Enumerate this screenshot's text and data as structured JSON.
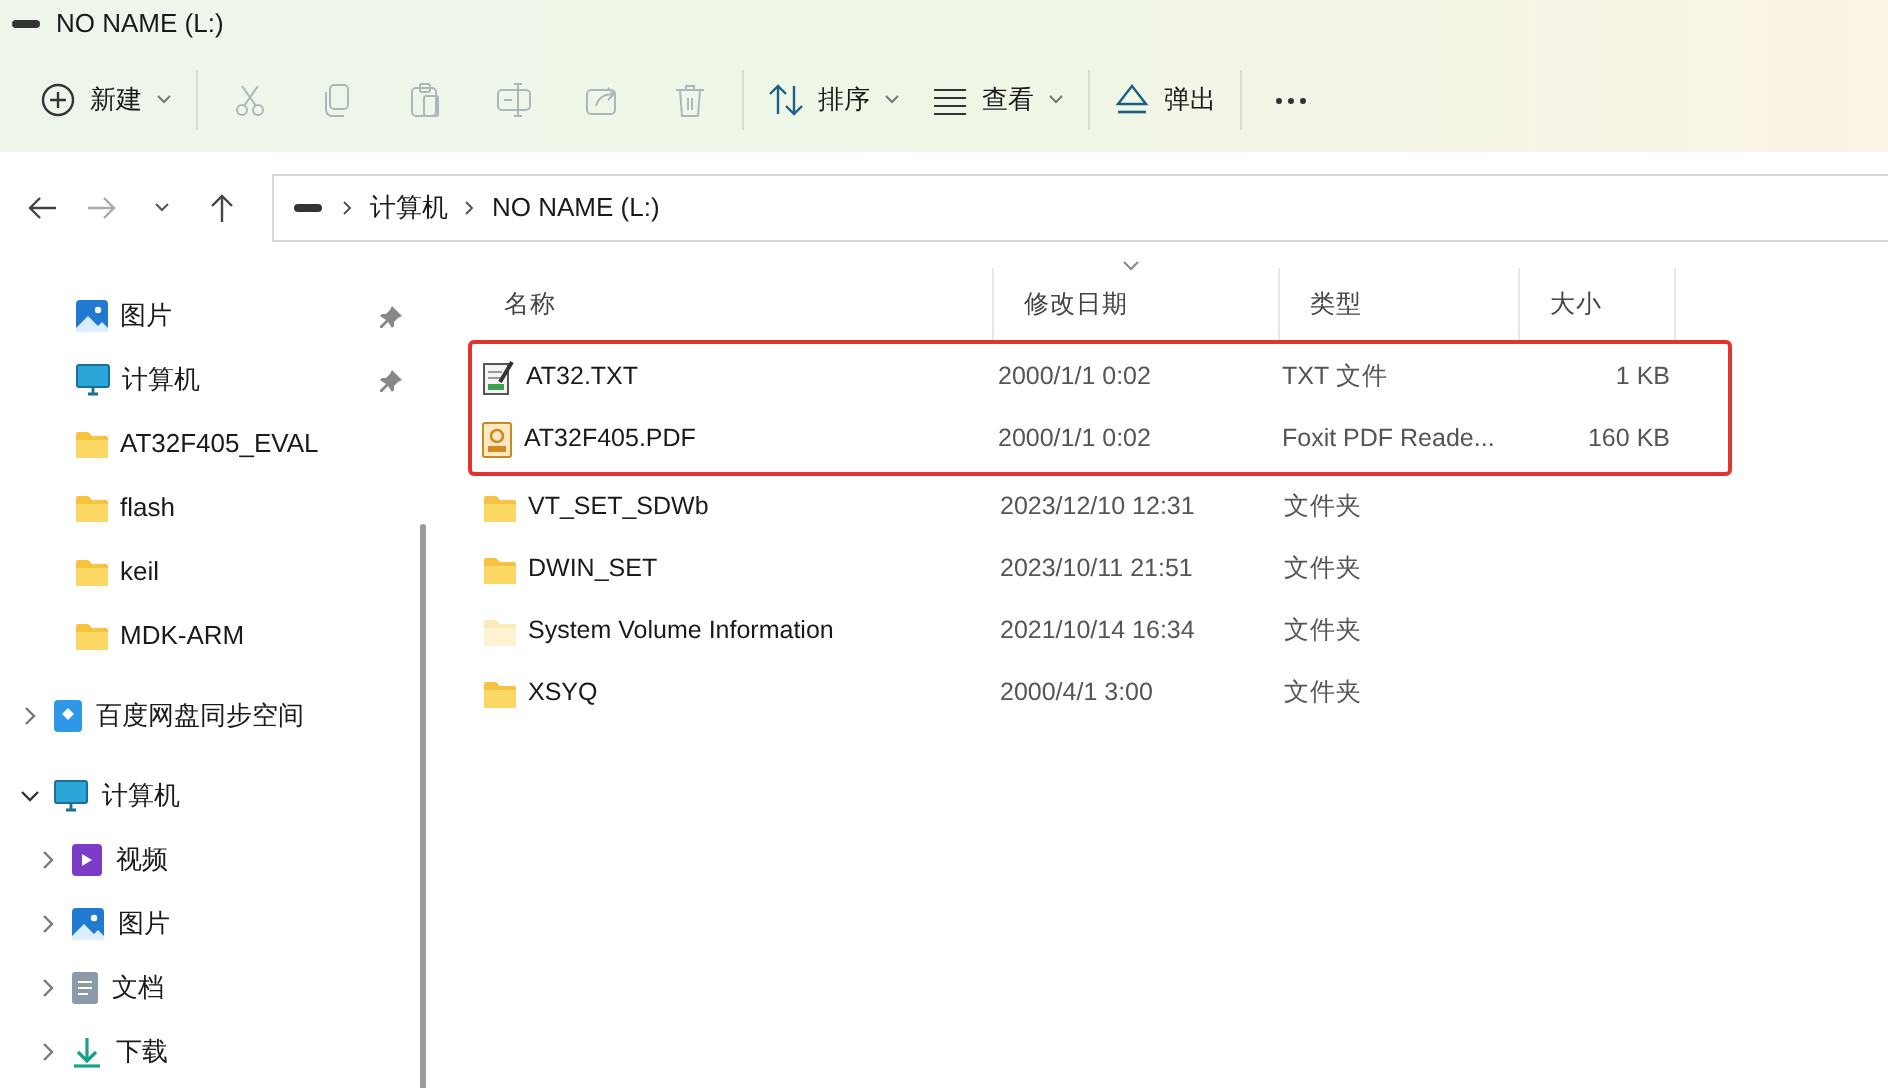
{
  "window": {
    "title": "NO NAME (L:)"
  },
  "toolbar": [
    {
      "kind": "new",
      "label": "新建",
      "disabled": false,
      "dropdown": true
    },
    {
      "kind": "cut",
      "disabled": true,
      "dropdown": false
    },
    {
      "kind": "copy",
      "disabled": true,
      "dropdown": false
    },
    {
      "kind": "paste",
      "disabled": true,
      "dropdown": false
    },
    {
      "kind": "rename",
      "disabled": true,
      "dropdown": false
    },
    {
      "kind": "share",
      "disabled": true,
      "dropdown": false
    },
    {
      "kind": "delete",
      "disabled": true,
      "dropdown": false
    },
    {
      "kind": "sort",
      "label": "排序",
      "disabled": false,
      "dropdown": true
    },
    {
      "kind": "view",
      "label": "查看",
      "disabled": false,
      "dropdown": true
    },
    {
      "kind": "eject",
      "label": "弹出",
      "disabled": false,
      "dropdown": false
    },
    {
      "kind": "more",
      "disabled": false,
      "dropdown": false
    }
  ],
  "navigation": {
    "back_disabled": false,
    "forward_disabled": true
  },
  "address_bar": {
    "crumbs": [
      "计算机",
      "NO NAME (L:)"
    ]
  },
  "sidebar": {
    "quick_access": [
      {
        "kind": "picture",
        "label": "图片",
        "pinned": true
      },
      {
        "kind": "computer",
        "label": "计算机",
        "pinned": true
      },
      {
        "kind": "folder",
        "label": "AT32F405_EVAL",
        "pinned": false
      },
      {
        "kind": "folder",
        "label": "flash",
        "pinned": false
      },
      {
        "kind": "folder",
        "label": "keil",
        "pinned": false
      },
      {
        "kind": "folder",
        "label": "MDK-ARM",
        "pinned": false
      }
    ],
    "tree": [
      {
        "kind": "cloud",
        "label": "百度网盘同步空间",
        "expanded": false
      },
      {
        "kind": "computer",
        "label": "计算机",
        "expanded": true,
        "children": [
          {
            "kind": "video",
            "label": "视频",
            "expanded": false
          },
          {
            "kind": "picture",
            "label": "图片",
            "expanded": false
          },
          {
            "kind": "document",
            "label": "文档",
            "expanded": false
          },
          {
            "kind": "download",
            "label": "下载",
            "expanded": false
          }
        ]
      }
    ]
  },
  "table": {
    "columns": [
      {
        "label": "名称",
        "sorted": false
      },
      {
        "label": "修改日期",
        "sorted": true
      },
      {
        "label": "类型",
        "sorted": false
      },
      {
        "label": "大小",
        "sorted": false
      }
    ],
    "rows": [
      {
        "kind": "text",
        "name": "AT32.TXT",
        "date": "2000/1/1 0:02",
        "type": "TXT 文件",
        "size": "1 KB",
        "highlighted": true,
        "hidden": false
      },
      {
        "kind": "pdf",
        "name": "AT32F405.PDF",
        "date": "2000/1/1 0:02",
        "type": "Foxit PDF Reade...",
        "size": "160 KB",
        "highlighted": true,
        "hidden": false
      },
      {
        "kind": "folder",
        "name": "VT_SET_SDWb",
        "date": "2023/12/10 12:31",
        "type": "文件夹",
        "highlighted": false,
        "hidden": false
      },
      {
        "kind": "folder",
        "name": "DWIN_SET",
        "date": "2023/10/11 21:51",
        "type": "文件夹",
        "highlighted": false,
        "hidden": false
      },
      {
        "kind": "folder",
        "name": "System Volume Information",
        "date": "2021/10/14 16:34",
        "type": "文件夹",
        "highlighted": false,
        "hidden": true
      },
      {
        "kind": "folder",
        "name": "XSYQ",
        "date": "2000/4/1 3:00",
        "type": "文件夹",
        "highlighted": false,
        "hidden": false
      }
    ]
  }
}
